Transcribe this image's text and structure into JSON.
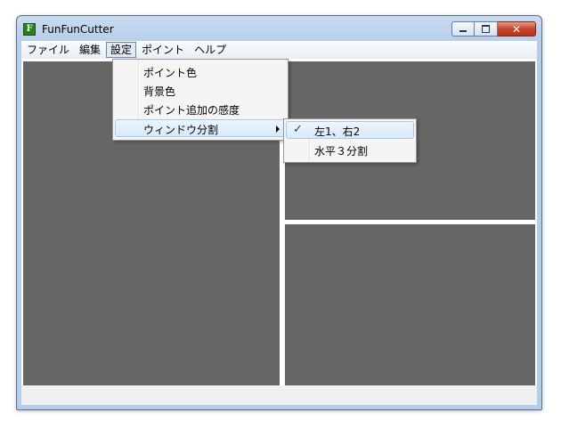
{
  "window": {
    "title": "FunFunCutter",
    "icon_letter": "F",
    "close_label": "✕"
  },
  "menubar": {
    "items": [
      "ファイル",
      "編集",
      "設定",
      "ポイント",
      "ヘルプ"
    ]
  },
  "settings_menu": {
    "items": [
      "ポイント色",
      "背景色",
      "ポイント追加の感度",
      "ウィンドウ分割"
    ]
  },
  "window_split_submenu": {
    "items": [
      "左1、右2",
      "水平３分割"
    ],
    "checked_index": 0,
    "check_glyph": "✓"
  },
  "colors": {
    "pane_background": "#666666",
    "accent_highlight": "#d9e9fa"
  }
}
